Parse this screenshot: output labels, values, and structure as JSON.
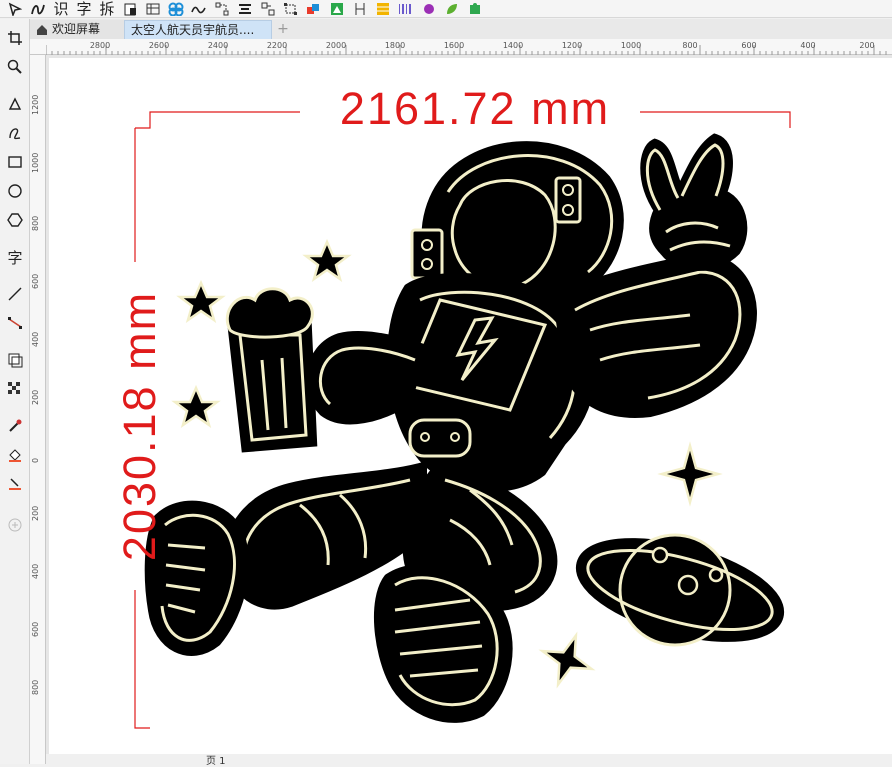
{
  "toolbar": {
    "text_icons": [
      "识",
      "字",
      "拆"
    ]
  },
  "tabs": {
    "home_label": "欢迎屏幕",
    "document_label": "太空人航天员宇航员....",
    "add_label": "+"
  },
  "ruler": {
    "horizontal_labels": [
      "2800",
      "2600",
      "2400",
      "2200",
      "2000",
      "1800",
      "1600",
      "1400",
      "1200",
      "1000",
      "800",
      "600",
      "400",
      "200"
    ],
    "vertical_labels": [
      "1200",
      "1000",
      "800",
      "600",
      "400",
      "200",
      "0",
      "200",
      "400",
      "600",
      "800"
    ]
  },
  "dimensions": {
    "width_label": "2161.72 mm",
    "height_label": "2030.18 mm",
    "color": "#e01b1b"
  },
  "status": {
    "page_label": "页 1"
  },
  "colors": {
    "artwork_fill": "#000000",
    "artwork_line": "#f3efc9"
  }
}
